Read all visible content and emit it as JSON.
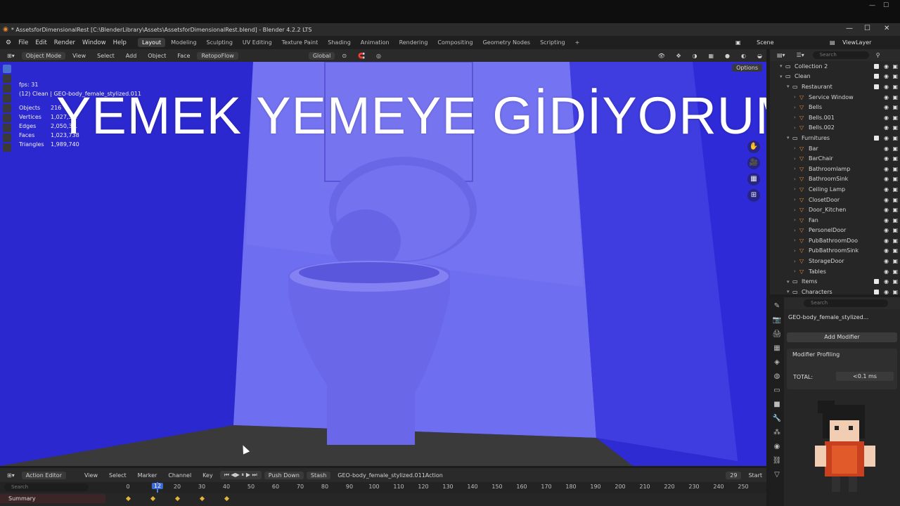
{
  "window": {
    "title": "* AssetsforDimensionalRest [C:\\BlenderLibrary\\Assets\\AssetsforDimensionalRest.blend] - Blender 4.2.2 LTS"
  },
  "menu": [
    "File",
    "Edit",
    "Render",
    "Window",
    "Help"
  ],
  "workspaces": [
    "Layout",
    "Modeling",
    "Sculpting",
    "UV Editing",
    "Texture Paint",
    "Shading",
    "Animation",
    "Rendering",
    "Compositing",
    "Geometry Nodes",
    "Scripting"
  ],
  "active_workspace": "Layout",
  "scene": {
    "label": "Scene",
    "view_layer": "ViewLayer"
  },
  "viewport_header": {
    "mode": "Object Mode",
    "items": [
      "View",
      "Select",
      "Add",
      "Object",
      "Face"
    ],
    "addon": "RetopoFlow",
    "transform": "Global",
    "options": "Options"
  },
  "stats": {
    "fps": "fps: 31",
    "context": "(12) Clean | GEO-body_female_stylized.011",
    "rows": [
      {
        "k": "Objects",
        "v": "216"
      },
      {
        "k": "Vertices",
        "v": "1,027,3..."
      },
      {
        "k": "Edges",
        "v": "2,050,3..."
      },
      {
        "k": "Faces",
        "v": "1,023,738"
      },
      {
        "k": "Triangles",
        "v": "1,989,740"
      }
    ]
  },
  "overlay_text": "YEMEK YEMEYE GİDİYORUM",
  "outliner": {
    "search_placeholder": "Search",
    "rows": [
      {
        "name": "Collection 2",
        "depth": 1,
        "kind": "coll"
      },
      {
        "name": "Clean",
        "depth": 1,
        "kind": "coll"
      },
      {
        "name": "Restaurant",
        "depth": 2,
        "kind": "coll"
      },
      {
        "name": "Service Window",
        "depth": 3,
        "kind": "obj"
      },
      {
        "name": "Bells",
        "depth": 3,
        "kind": "obj"
      },
      {
        "name": "Bells.001",
        "depth": 3,
        "kind": "obj"
      },
      {
        "name": "Bells.002",
        "depth": 3,
        "kind": "obj"
      },
      {
        "name": "Furnitures",
        "depth": 2,
        "kind": "coll"
      },
      {
        "name": "Bar",
        "depth": 3,
        "kind": "obj"
      },
      {
        "name": "BarChair",
        "depth": 3,
        "kind": "obj"
      },
      {
        "name": "Bathroomlamp",
        "depth": 3,
        "kind": "obj"
      },
      {
        "name": "BathroomSink",
        "depth": 3,
        "kind": "obj"
      },
      {
        "name": "Ceiling Lamp",
        "depth": 3,
        "kind": "obj"
      },
      {
        "name": "ClosetDoor",
        "depth": 3,
        "kind": "obj"
      },
      {
        "name": "Door_Kitchen",
        "depth": 3,
        "kind": "obj"
      },
      {
        "name": "Fan",
        "depth": 3,
        "kind": "obj"
      },
      {
        "name": "PersonelDoor",
        "depth": 3,
        "kind": "obj"
      },
      {
        "name": "PubBathroomDoo",
        "depth": 3,
        "kind": "obj"
      },
      {
        "name": "PubBathroomSink",
        "depth": 3,
        "kind": "obj"
      },
      {
        "name": "StorageDoor",
        "depth": 3,
        "kind": "obj"
      },
      {
        "name": "Tables",
        "depth": 3,
        "kind": "obj"
      },
      {
        "name": "Items",
        "depth": 2,
        "kind": "coll"
      },
      {
        "name": "Characters",
        "depth": 2,
        "kind": "coll"
      }
    ]
  },
  "properties": {
    "search_placeholder": "Search",
    "object_name": "GEO-body_female_stylized...",
    "add_modifier": "Add Modifier",
    "panel_title": "Modifier Profiling",
    "total_label": "TOTAL:",
    "total_value": "<0.1 ms"
  },
  "timeline": {
    "editor": "Action Editor",
    "menus": [
      "View",
      "Select",
      "Marker",
      "Channel",
      "Key"
    ],
    "push_down": "Push Down",
    "stash": "Stash",
    "action": "GEO-body_female_stylized.011Action",
    "current_frame": "12",
    "frame_field": "29",
    "start": "Start",
    "search_placeholder": "Search",
    "summary": "Summary",
    "ticks": [
      "0",
      "20",
      "30",
      "40",
      "50",
      "60",
      "70",
      "80",
      "90",
      "100",
      "110",
      "120",
      "130",
      "140",
      "150",
      "160",
      "170",
      "180",
      "190",
      "200",
      "210",
      "220",
      "230",
      "240",
      "250"
    ]
  },
  "colors": {
    "viewport_bg": "#2f2bd2",
    "accent": "#4b7de8",
    "keyframe": "#e2b43a"
  }
}
